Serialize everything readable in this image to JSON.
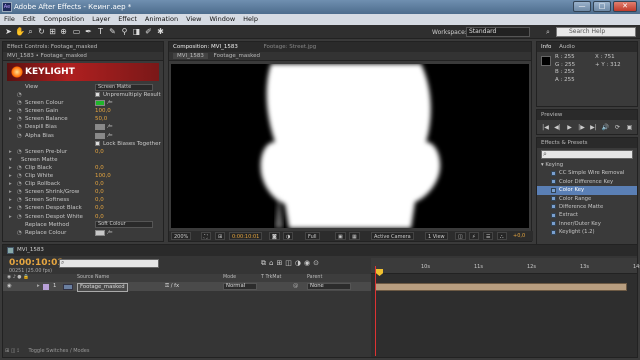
{
  "window": {
    "title": "Adobe After Effects - Кеинг.aep *",
    "min": "—",
    "max": "□",
    "close": "✕",
    "app_icon": "Ae"
  },
  "menu": [
    "File",
    "Edit",
    "Composition",
    "Layer",
    "Effect",
    "Animation",
    "View",
    "Window",
    "Help"
  ],
  "toolbar": {
    "workspace_label": "Workspace:",
    "workspace_value": "Standard",
    "search_help_placeholder": "Search Help"
  },
  "effect_controls": {
    "tab": "Effect Controls: Footage_masked",
    "breadcrumb": "MVI_1583 • Footage_masked",
    "plugin_name": "KEYLIGHT",
    "properties": [
      {
        "name": "View",
        "kind": "dropdown",
        "value": "Screen Matte",
        "twirl": "",
        "stopwatch": ""
      },
      {
        "name": "",
        "kind": "checkbox",
        "value": "Unpremultiply Result",
        "twirl": "",
        "stopwatch": "◔"
      },
      {
        "name": "Screen Colour",
        "kind": "color",
        "value": "#1fb52a",
        "twirl": "",
        "stopwatch": "◔"
      },
      {
        "name": "Screen Gain",
        "kind": "number",
        "value": "100,0",
        "twirl": "▸",
        "stopwatch": "◔"
      },
      {
        "name": "Screen Balance",
        "kind": "number",
        "value": "50,0",
        "twirl": "▸",
        "stopwatch": "◔"
      },
      {
        "name": "Despill Bias",
        "kind": "color",
        "value": "#8a8a8a",
        "twirl": "",
        "stopwatch": "◔"
      },
      {
        "name": "Alpha Bias",
        "kind": "color",
        "value": "#8a8a8a",
        "twirl": "",
        "stopwatch": "◔"
      },
      {
        "name": "",
        "kind": "checkbox",
        "value": "Lock Biases Together",
        "twirl": "",
        "stopwatch": ""
      },
      {
        "name": "Screen Pre-blur",
        "kind": "number",
        "value": "0,0",
        "twirl": "▸",
        "stopwatch": "◔"
      },
      {
        "name": "Screen Matte",
        "kind": "group",
        "value": "",
        "twirl": "▾",
        "stopwatch": ""
      },
      {
        "name": "Clip Black",
        "kind": "number",
        "value": "0,0",
        "twirl": "▸",
        "stopwatch": "◔"
      },
      {
        "name": "Clip White",
        "kind": "number",
        "value": "100,0",
        "twirl": "▸",
        "stopwatch": "◔"
      },
      {
        "name": "Clip Rollback",
        "kind": "number",
        "value": "0,0",
        "twirl": "▸",
        "stopwatch": "◔"
      },
      {
        "name": "Screen Shrink/Grow",
        "kind": "number",
        "value": "0,0",
        "twirl": "▸",
        "stopwatch": "◔"
      },
      {
        "name": "Screen Softness",
        "kind": "number",
        "value": "0,0",
        "twirl": "▸",
        "stopwatch": "◔"
      },
      {
        "name": "Screen Despot Black",
        "kind": "number",
        "value": "0,0",
        "twirl": "▸",
        "stopwatch": "◔"
      },
      {
        "name": "Screen Despot White",
        "kind": "number",
        "value": "0,0",
        "twirl": "▸",
        "stopwatch": "◔"
      },
      {
        "name": "Replace Method",
        "kind": "dropdown",
        "value": "Soft Colour",
        "twirl": "",
        "stopwatch": ""
      },
      {
        "name": "Replace Colour",
        "kind": "color",
        "value": "#c8c8c8",
        "twirl": "",
        "stopwatch": "◔"
      }
    ]
  },
  "composition": {
    "tab": "Composition: MVI_1583",
    "footage_tab": "Footage: Street.jpg",
    "subtabs": [
      "MVI_1583",
      "Footage_masked"
    ],
    "zoom": "200%",
    "timecode": "0:00:10:01",
    "resolution": "Full",
    "camera": "Active Camera",
    "views": "1 View",
    "exposure": "+0,0"
  },
  "info": {
    "tab": "Info",
    "tab2": "Audio",
    "r": "R : 255",
    "g": "G : 255",
    "b": "B : 255",
    "a": "A : 255",
    "x": "X : 751",
    "y": "+ Y : 312"
  },
  "preview": {
    "tab": "Preview",
    "buttons": [
      "|◀",
      "◀|",
      "▶",
      "|▶",
      "▶|",
      "🔊",
      "⟳",
      "▣"
    ]
  },
  "effects_presets": {
    "tab": "Effects & Presets",
    "search_value": "",
    "category": "▾ Keying",
    "items": [
      "CC Simple Wire Removal",
      "Color Difference Key",
      "Color Key",
      "Color Range",
      "Difference Matte",
      "Extract",
      "Inner/Outer Key",
      "Keylight (1.2)"
    ],
    "selected_index": 2
  },
  "timeline": {
    "tab": "MVI_1583",
    "timecode": "0:00:10:01",
    "fps": "00251 (25.00 fps)",
    "columns": [
      "Source Name",
      "Mode",
      "T TrkMat",
      "Parent"
    ],
    "layer": {
      "number": "1",
      "name": "Footage_masked",
      "mode": "Normal",
      "parent": "None"
    },
    "ruler_ticks": [
      "10s",
      "11s",
      "12s",
      "13s",
      "14s"
    ]
  }
}
